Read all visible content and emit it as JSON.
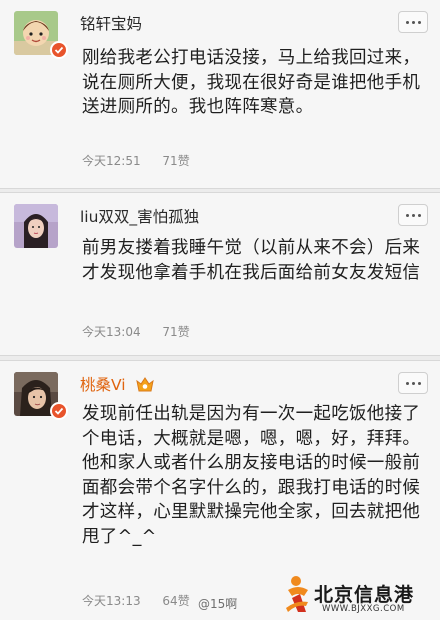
{
  "comments": [
    {
      "username": "铭轩宝妈",
      "text": "刚给我老公打电话没接，马上给我回过来，说在厕所大便，我现在很好奇是谁把他手机送进厕所的。我也阵阵寒意。",
      "time": "今天12:51",
      "likes": "71赞",
      "verified_badge": true,
      "avatar_icon": "cartoon-avatar"
    },
    {
      "username": "liu双双_害怕孤独",
      "text": "前男友搂着我睡午觉（以前从来不会）后来才发现他拿着手机在我后面给前女友发短信",
      "time": "今天13:04",
      "likes": "71赞",
      "verified_badge": false,
      "avatar_icon": "girl-photo-avatar"
    },
    {
      "username": "桃桑Vi",
      "text": "发现前任出轨是因为有一次一起吃饭他接了个电话，大概就是嗯，嗯，嗯，好，拜拜。他和家人或者什么朋友接电话的时候一般前面都会带个名字什么的，跟我打电话的时候才这样，心里默默操完他全家，回去就把他甩了^_^",
      "time": "今天13:13",
      "likes": "64赞",
      "verified_badge": true,
      "vip": true,
      "avatar_icon": "portrait-photo-avatar"
    }
  ],
  "watermark": {
    "handle": "@15啊",
    "logo_name": "北京信息港",
    "logo_url": "WWW.BJXXG.COM"
  },
  "colors": {
    "vip_name": "#e0640f",
    "badge": "#e8542c"
  }
}
